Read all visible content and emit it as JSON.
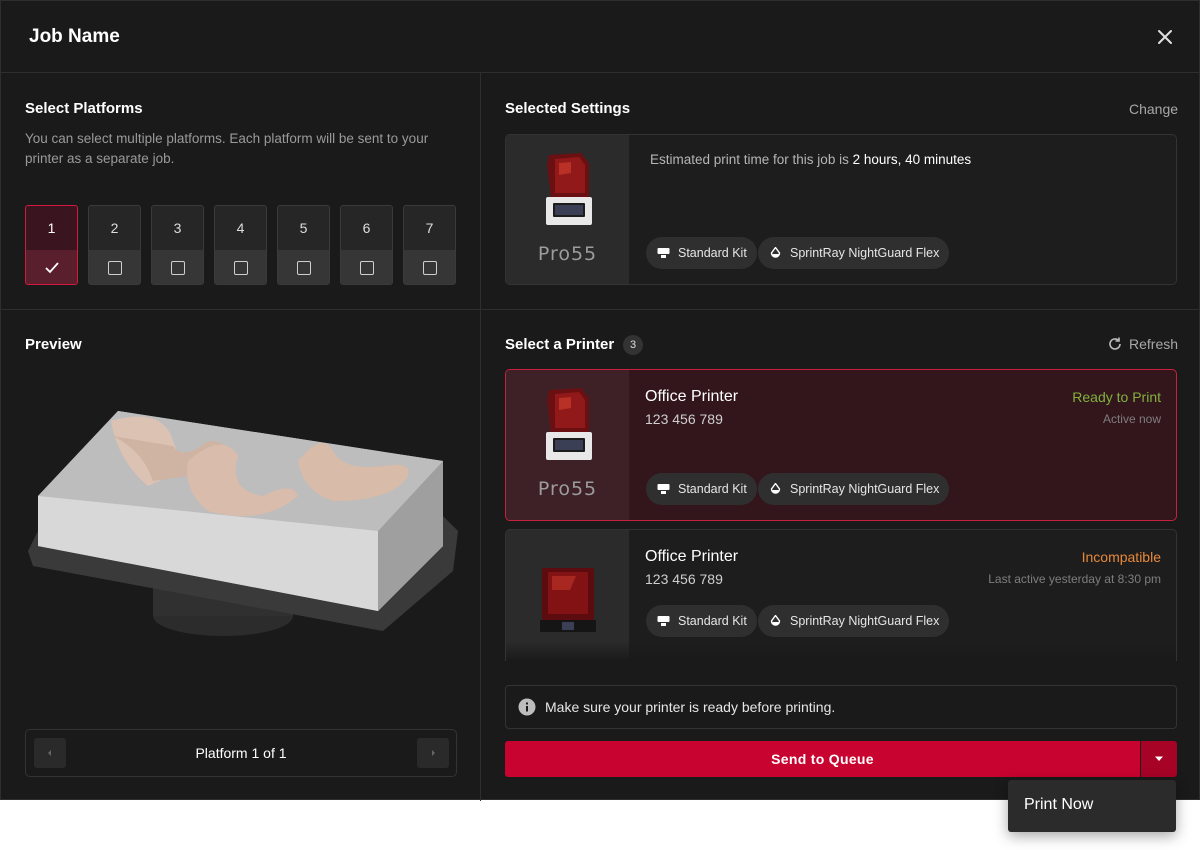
{
  "header": {
    "title": "Job Name"
  },
  "platforms": {
    "title": "Select Platforms",
    "description": "You can select multiple platforms. Each platform will be sent to your printer as a separate job.",
    "items": [
      {
        "label": "1",
        "selected": true
      },
      {
        "label": "2",
        "selected": false
      },
      {
        "label": "3",
        "selected": false
      },
      {
        "label": "4",
        "selected": false
      },
      {
        "label": "5",
        "selected": false
      },
      {
        "label": "6",
        "selected": false
      },
      {
        "label": "7",
        "selected": false
      }
    ]
  },
  "settings": {
    "title": "Selected Settings",
    "change_label": "Change",
    "printer_model": "Pro55",
    "estimate_prefix": "Estimated print time for this job is ",
    "estimate_value": "2 hours, 40 minutes",
    "kit": "Standard Kit",
    "resin": "SprintRay NightGuard Flex"
  },
  "preview": {
    "title": "Preview",
    "pager_label": "Platform 1 of 1"
  },
  "printers": {
    "title": "Select a Printer",
    "count": "3",
    "refresh_label": "Refresh",
    "items": [
      {
        "name": "Office Printer",
        "serial": "123 456 789",
        "status": "Ready to Print",
        "status_color": "#7fb33d",
        "activity": "Active now",
        "model": "Pro55",
        "kit": "Standard Kit",
        "resin": "SprintRay NightGuard Flex"
      },
      {
        "name": "Office Printer",
        "serial": "123 456 789",
        "status": "Incompatible",
        "status_color": "#e8893a",
        "activity": "Last active yesterday at 8:30 pm",
        "kit": "Standard Kit",
        "resin": "SprintRay NightGuard Flex"
      }
    ]
  },
  "notice": {
    "text": "Make sure your printer is ready before printing."
  },
  "actions": {
    "primary_label": "Send to Queue",
    "menu_items": [
      "Print Now"
    ]
  },
  "colors": {
    "accent": "#c8032f",
    "background": "#1a1a1a"
  }
}
